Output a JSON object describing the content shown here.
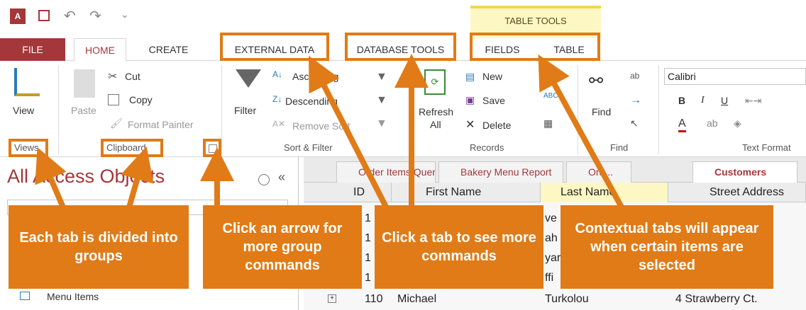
{
  "contextual_header": "TABLE TOOLS",
  "tabs": {
    "file": "FILE",
    "home": "HOME",
    "create": "CREATE",
    "external_data": "EXTERNAL DATA",
    "database_tools": "DATABASE TOOLS",
    "fields": "FIELDS",
    "table": "TABLE"
  },
  "ribbon": {
    "views": {
      "view": "View",
      "group": "Views"
    },
    "clipboard": {
      "paste": "Paste",
      "cut": "Cut",
      "copy": "Copy",
      "format_painter": "Format Painter",
      "group": "Clipboard"
    },
    "sort_filter": {
      "filter": "Filter",
      "ascending": "Ascending",
      "descending": "Descending",
      "remove_sort": "Remove Sort",
      "group": "Sort & Filter"
    },
    "records": {
      "refresh": "Refresh",
      "refresh_all": "All",
      "new": "New",
      "save": "Save",
      "delete": "Delete",
      "group": "Records"
    },
    "find": {
      "find": "Find",
      "group": "Find"
    },
    "text_formatting": {
      "font": "Calibri",
      "bold": "B",
      "italic": "I",
      "underline": "U",
      "group": "Text Format"
    }
  },
  "nav_pane": {
    "title": "All Access Objects",
    "menu_items": "Menu Items"
  },
  "doc_tabs": [
    "Order Items Query",
    "Bakery Menu Report",
    "Ord...",
    "Customers"
  ],
  "columns": [
    "ID",
    "First Name",
    "Last Name",
    "Street Address"
  ],
  "row": {
    "id": "110",
    "first": "Michael",
    "last": "Turkolou",
    "street": "4 Strawberry Ct."
  },
  "partial_rows": {
    "ids": [
      "1",
      "1",
      "1",
      "1"
    ],
    "last": [
      "ve",
      "ah",
      "yar",
      "ffi"
    ]
  },
  "callouts": {
    "groups": "Each tab is divided into groups",
    "arrow": "Click an arrow for more group commands",
    "tab": "Click a tab to see more commands",
    "contextual": "Contextual tabs will appear when certain items are selected"
  },
  "colors": {
    "accent": "#a4373a",
    "callout": "#e07b17",
    "contextual": "#fdf7c4"
  }
}
